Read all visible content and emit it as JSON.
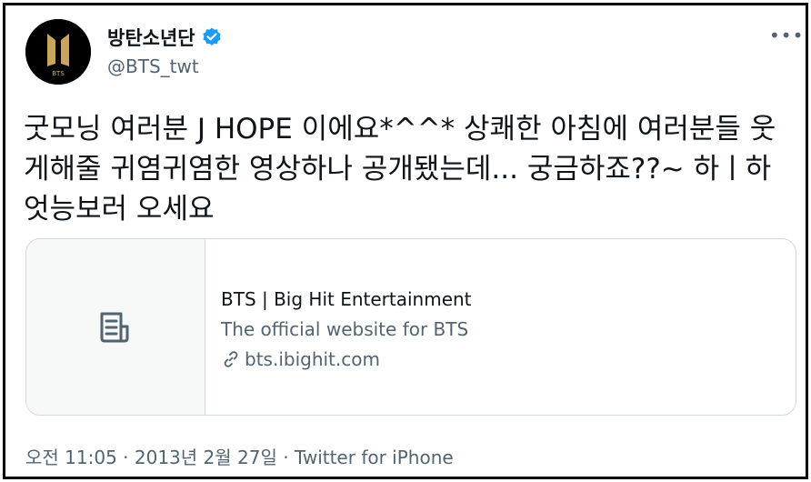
{
  "author": {
    "display_name": "방탄소년단",
    "handle": "@BTS_twt",
    "avatar_text": "BTS",
    "verified_icon": "verified-badge-icon"
  },
  "more_menu": {
    "label": "•••",
    "icon": "more-options-icon"
  },
  "tweet": {
    "text": "굿모닝 여러분 J HOPE 이에요*^^* 상쾌한 아침에 여러분들 웃게해줄 귀염귀염한 영상하나 공개됐는데... 궁금하죠??~ 하ㅣ하 엇능보러 오세요"
  },
  "link_card": {
    "icon": "document-icon",
    "title": "BTS | Big Hit Entertainment",
    "description": "The official website for BTS",
    "domain_icon": "link-icon",
    "domain": "bts.ibighit.com"
  },
  "meta": {
    "timestamp": "오전 11:05 · 2013년 2월 27일 · Twitter for iPhone"
  },
  "colors": {
    "text_primary": "#0f1419",
    "text_secondary": "#536471",
    "verified_blue": "#1d9bf0",
    "border": "#cfd9de",
    "logo_gold": "#c9a45c"
  }
}
